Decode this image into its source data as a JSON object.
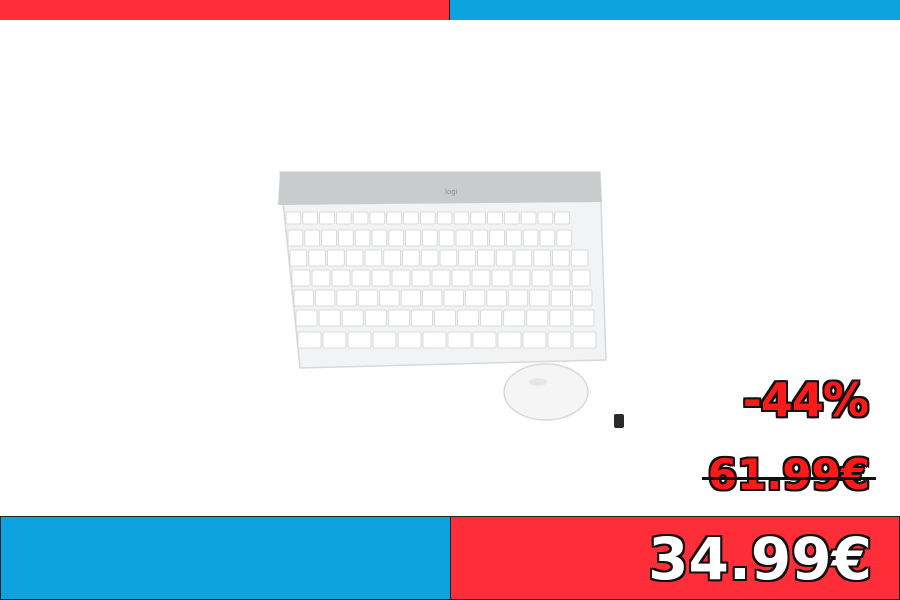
{
  "discount_label": "-44%",
  "old_price": "61.99€",
  "new_price": "34.99€",
  "product_image": "wireless-keyboard-and-mouse-combo",
  "colors": {
    "red": "#ff2d37",
    "blue": "#0ea2e0",
    "price_red": "#ff1a1a"
  }
}
